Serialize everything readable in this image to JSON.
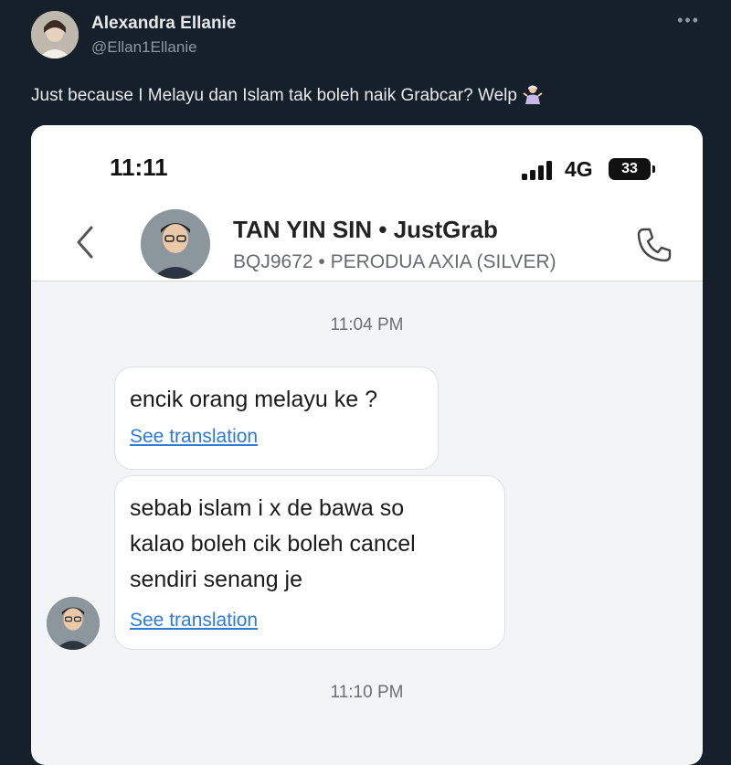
{
  "tweet": {
    "author_name": "Alexandra Ellanie",
    "author_handle": "@Ellan1Ellanie",
    "more_icon": "more-horizontal-icon",
    "text": "Just because I Melayu dan Islam tak boleh naik Grabcar? Welp",
    "emoji": "person-shrugging-emoji"
  },
  "phone": {
    "status_time": "11:11",
    "network": "4G",
    "battery": "33"
  },
  "chat": {
    "driver_name": "TAN YIN SIN • JustGrab",
    "car_info": "BQJ9672 • PERODUA AXIA (SILVER)",
    "timestamp_1": "11:04 PM",
    "timestamp_2": "11:10 PM",
    "messages": [
      {
        "lines": [
          "encik orang melayu ke ?"
        ],
        "translate": "See translation"
      },
      {
        "lines": [
          "sebab islam i x de bawa so",
          "kalao boleh cik boleh  cancel",
          "sendiri senang je"
        ],
        "translate": "See translation"
      }
    ]
  },
  "colors": {
    "background": "#15202b",
    "link": "#2e7ad9"
  }
}
